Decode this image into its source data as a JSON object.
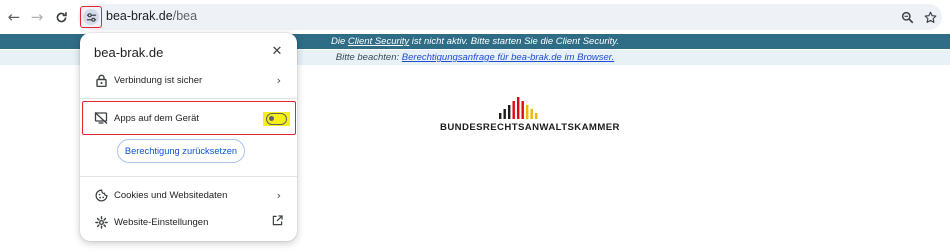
{
  "browser": {
    "url_host": "bea-brak.de",
    "url_path": "/bea"
  },
  "banners": {
    "client_prefix": "Die ",
    "client_link": "Client Security",
    "client_suffix": " ist nicht aktiv. Bitte starten Sie die Client Security.",
    "permission_prefix": "Bitte beachten: ",
    "permission_link": "Berechtigungsanfrage für bea-brak.de im Browser."
  },
  "logo": {
    "text": "BUNDESRECHTSANWALTSKAMMER",
    "colors": [
      "#1d1d1b",
      "#1d1d1b",
      "#1d1d1b",
      "#e30613",
      "#e30613",
      "#e30613",
      "#f5b400",
      "#f5b400",
      "#f5b400"
    ]
  },
  "popup": {
    "title": "bea-brak.de",
    "items": {
      "connection": "Verbindung ist sicher",
      "apps": "Apps auf dem Gerät",
      "reset": "Berechtigung zurücksetzen",
      "cookies": "Cookies und Websitedaten",
      "settings": "Website-Einstellungen"
    },
    "apps_toggle_on": false
  },
  "colors": {
    "banner_dark": "#2f6c86",
    "banner_light": "#e7f1f6",
    "highlight_red": "#e0262e",
    "highlight_yellow": "#f7ef1c",
    "link_blue": "#0b57d0"
  }
}
